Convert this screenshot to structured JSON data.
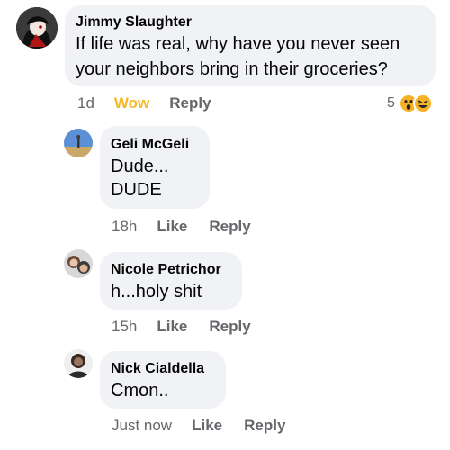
{
  "comments": [
    {
      "author": "Jimmy Slaughter",
      "lines": [
        "If life was real, why have you never seen",
        "your neighbors bring in their groceries?"
      ],
      "time": "1d",
      "reaction_label": "Wow",
      "reply": "Reply",
      "reaction_count": "5"
    },
    {
      "author": "Geli McGeli",
      "lines": [
        "Dude...",
        "DUDE"
      ],
      "time": "18h",
      "like": "Like",
      "reply": "Reply"
    },
    {
      "author": "Nicole Petrichor",
      "lines": [
        "h...holy shit"
      ],
      "time": "15h",
      "like": "Like",
      "reply": "Reply"
    },
    {
      "author": "Nick Cialdella",
      "lines": [
        "Cmon.."
      ],
      "time": "Just now",
      "like": "Like",
      "reply": "Reply"
    }
  ],
  "colors": {
    "bubble": "#f0f2f5",
    "action_text": "#65676b",
    "wow_yellow": "#f7b928"
  },
  "icons": [
    "wow-reaction-icon",
    "haha-reaction-icon"
  ]
}
